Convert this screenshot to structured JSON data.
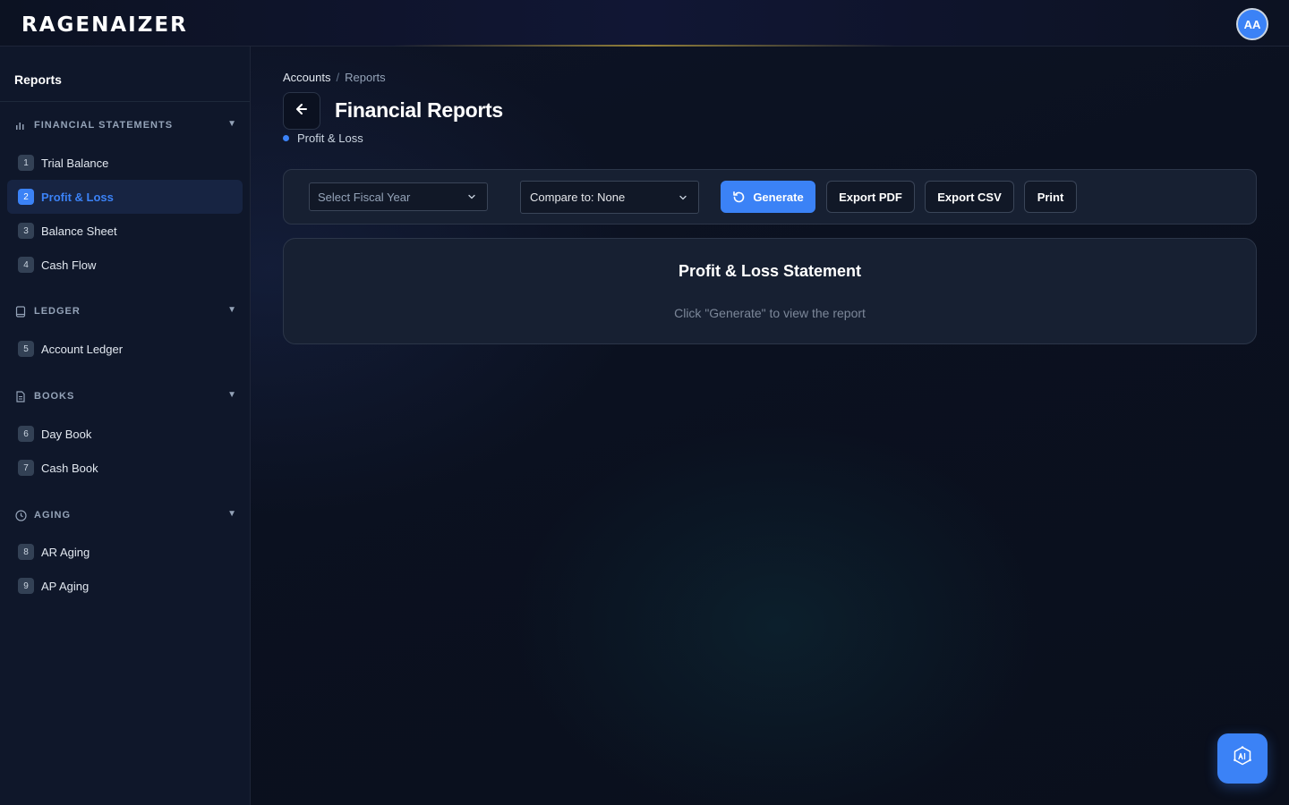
{
  "app": {
    "logo": "RAGENAIZER",
    "user_initials": "AA"
  },
  "sidebar": {
    "title": "Reports",
    "sections": [
      {
        "label": "FINANCIAL STATEMENTS",
        "icon": "bar-chart-icon",
        "items": [
          {
            "num": "1",
            "label": "Trial Balance"
          },
          {
            "num": "2",
            "label": "Profit & Loss",
            "active": true
          },
          {
            "num": "3",
            "label": "Balance Sheet"
          },
          {
            "num": "4",
            "label": "Cash Flow"
          }
        ]
      },
      {
        "label": "LEDGER",
        "icon": "book-icon",
        "items": [
          {
            "num": "5",
            "label": "Account Ledger"
          }
        ]
      },
      {
        "label": "BOOKS",
        "icon": "document-icon",
        "items": [
          {
            "num": "6",
            "label": "Day Book"
          },
          {
            "num": "7",
            "label": "Cash Book"
          }
        ]
      },
      {
        "label": "AGING",
        "icon": "clock-icon",
        "items": [
          {
            "num": "8",
            "label": "AR Aging"
          },
          {
            "num": "9",
            "label": "AP Aging"
          }
        ]
      }
    ]
  },
  "breadcrumb": {
    "root": "Accounts",
    "separator": "/",
    "current": "Reports"
  },
  "page": {
    "title": "Financial Reports",
    "subtitle": "Profit & Loss"
  },
  "toolbar": {
    "fiscal_year_placeholder": "Select Fiscal Year",
    "compare_value": "Compare to: None",
    "generate_label": "Generate",
    "export_pdf_label": "Export PDF",
    "export_csv_label": "Export CSV",
    "print_label": "Print"
  },
  "report": {
    "title": "Profit & Loss Statement",
    "hint": "Click \"Generate\" to view the report"
  },
  "colors": {
    "accent": "#3b82f6",
    "background": "#0b1120",
    "panel": "#172032"
  }
}
